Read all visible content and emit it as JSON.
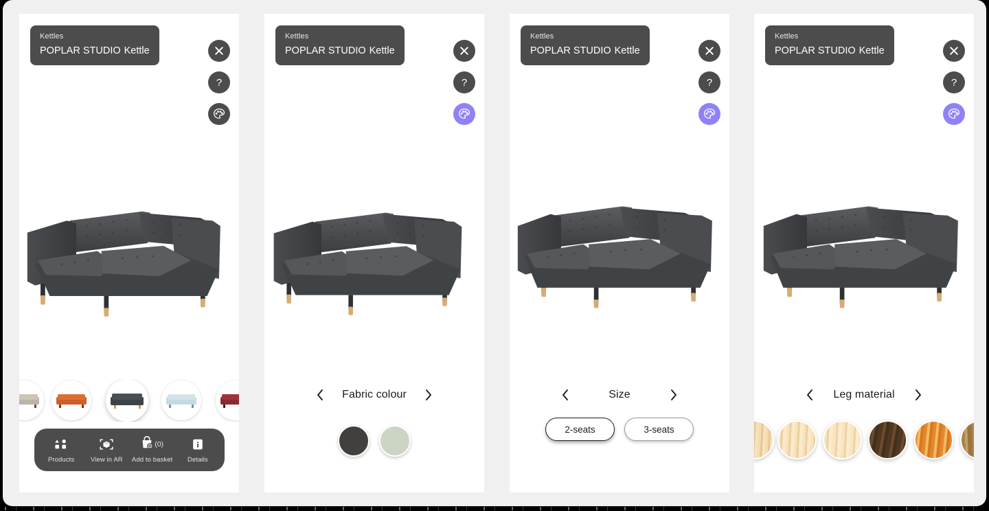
{
  "app": {
    "background_color": "#f0f0f0",
    "panel_color": "#ffffff",
    "chip_color": "#4c4c4c",
    "accent_color": "#8f82f5"
  },
  "product": {
    "brand_line": "Kettles",
    "name_main": "POPLAR STUDIO",
    "name_sub": "Kettle"
  },
  "actions": {
    "close_label": "Close",
    "help_label": "Help",
    "palette_label": "Customise"
  },
  "navbar": {
    "items": [
      {
        "label": "Products",
        "icon": "grid-shapes-icon"
      },
      {
        "label": "View in AR",
        "icon": "ar-cube-icon"
      },
      {
        "label": "Add to basket",
        "icon": "basket-add-icon",
        "count": "(0)"
      },
      {
        "label": "Details",
        "icon": "info-icon"
      }
    ]
  },
  "product_thumbnails": [
    {
      "name": "beige-sofa",
      "color": "#b8aea1"
    },
    {
      "name": "orange-sofa",
      "color": "#d2602c"
    },
    {
      "name": "dark-grey-sofa",
      "color": "#44474a",
      "selected": true
    },
    {
      "name": "light-blue-sofa",
      "color": "#bed7dc"
    },
    {
      "name": "dark-red-sofa",
      "color": "#8d2730"
    }
  ],
  "panels": [
    {
      "id": "panel-0",
      "mode": "products",
      "palette_active": false,
      "sofa_variant": "dark-grey-2seat"
    },
    {
      "id": "panel-1",
      "mode": "fabric-colour",
      "palette_active": true,
      "sofa_variant": "dark-grey-2seat",
      "chooser": {
        "title": "Fabric colour",
        "prev_label": "Previous option",
        "next_label": "Next option",
        "swatches": [
          {
            "name": "dark-grey",
            "color": "#41403d",
            "selected": true
          },
          {
            "name": "sage-green",
            "color": "#ccd4c2",
            "selected": false
          }
        ]
      }
    },
    {
      "id": "panel-2",
      "mode": "size",
      "palette_active": true,
      "sofa_variant": "dark-grey-3seat",
      "chooser": {
        "title": "Size",
        "prev_label": "Previous option",
        "next_label": "Next option",
        "options": [
          {
            "label": "2-seats",
            "selected": true
          },
          {
            "label": "3-seats",
            "selected": false
          }
        ]
      }
    },
    {
      "id": "panel-3",
      "mode": "leg-material",
      "palette_active": true,
      "sofa_variant": "dark-grey-3seat",
      "chooser": {
        "title": "Leg material",
        "prev_label": "Previous option",
        "next_label": "Next option",
        "materials": [
          {
            "name": "pale-birch-partial",
            "c1": "#f0d9ae",
            "c2": "#e2c391"
          },
          {
            "name": "light-maple",
            "c1": "#f5e0bb",
            "c2": "#e9cf9f"
          },
          {
            "name": "light-pine",
            "c1": "#f7e2bd",
            "c2": "#ead0a1"
          },
          {
            "name": "dark-walnut",
            "c1": "#4d3421",
            "c2": "#6b4a2d"
          },
          {
            "name": "golden-oak",
            "c1": "#e08a33",
            "c2": "#f3b45c"
          },
          {
            "name": "natural-olive",
            "c1": "#a9834c",
            "c2": "#c49a61"
          }
        ]
      }
    }
  ]
}
